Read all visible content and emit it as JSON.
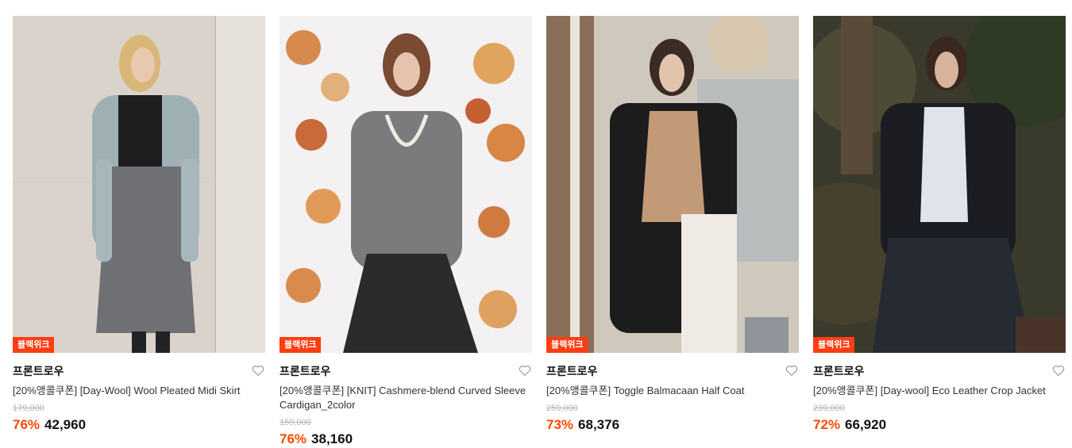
{
  "colors": {
    "accent": "#ff3d13",
    "discount": "#ff4800",
    "strikethrough": "#b5b5b5"
  },
  "products": [
    {
      "badge": "블랙위크",
      "brand": "프론트로우",
      "title": "[20%앵콜쿠폰] [Day-Wool] Wool Pleated Midi Skirt",
      "original_price": "179,000",
      "discount": "76%",
      "price": "42,960",
      "wish_icon": "heart-outline-icon"
    },
    {
      "badge": "블랙위크",
      "brand": "프론트로우",
      "title": "[20%앵콜쿠폰] [KNIT] Cashmere-blend Curved Sleeve Cardigan_2color",
      "original_price": "159,000",
      "discount": "76%",
      "price": "38,160",
      "wish_icon": "heart-outline-icon"
    },
    {
      "badge": "블랙위크",
      "brand": "프론트로우",
      "title": "[20%앵콜쿠폰] Toggle Balmacaan Half Coat",
      "original_price": "259,000",
      "discount": "73%",
      "price": "68,376",
      "wish_icon": "heart-outline-icon"
    },
    {
      "badge": "블랙위크",
      "brand": "프론트로우",
      "title": "[20%앵콜쿠폰] [Day-wool] Eco Leather Crop Jacket",
      "original_price": "239,000",
      "discount": "72%",
      "price": "66,920",
      "wish_icon": "heart-outline-icon"
    }
  ]
}
